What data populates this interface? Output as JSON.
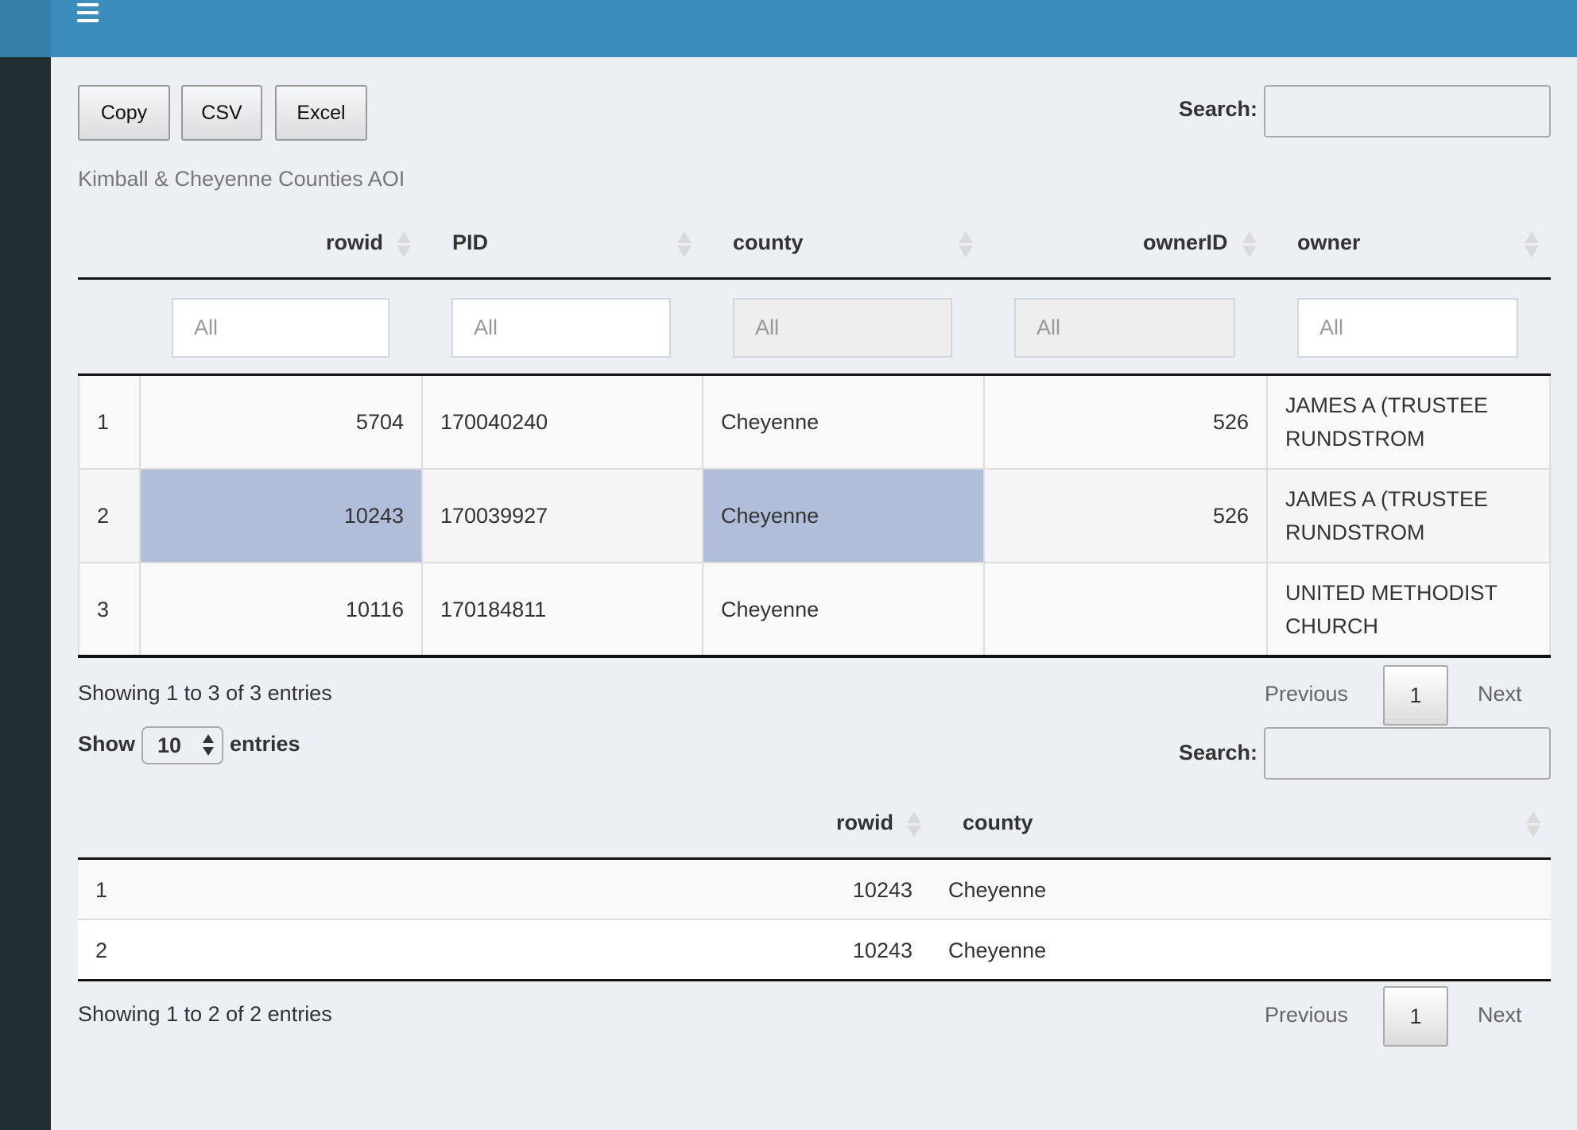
{
  "header": {
    "menu_icon": "hamburger-icon",
    "colors": {
      "header": "#3c8dbc",
      "logo_area": "#367fa9",
      "sidebar": "#222d32",
      "content_bg": "#ecf0f5",
      "selected_cell": "#b0bed9"
    }
  },
  "toolbar": {
    "copy_label": "Copy",
    "csv_label": "CSV",
    "excel_label": "Excel"
  },
  "table1": {
    "search_label": "Search:",
    "search_value": "",
    "caption": "Kimball & Cheyenne Counties AOI",
    "columns": [
      {
        "label": "",
        "sortable": false
      },
      {
        "label": "rowid",
        "sortable": true
      },
      {
        "label": "PID",
        "sortable": true
      },
      {
        "label": "county",
        "sortable": true
      },
      {
        "label": "ownerID",
        "sortable": true
      },
      {
        "label": "owner",
        "sortable": true
      }
    ],
    "filters": [
      {
        "placeholder": "All",
        "disabled": false
      },
      {
        "placeholder": "All",
        "disabled": false
      },
      {
        "placeholder": "All",
        "disabled": true
      },
      {
        "placeholder": "All",
        "disabled": true
      },
      {
        "placeholder": "All",
        "disabled": false
      }
    ],
    "rows": [
      {
        "index": "1",
        "rowid": "5704",
        "pid": "170040240",
        "county": "Cheyenne",
        "ownerID": "526",
        "owner": "JAMES A (TRUSTEE RUNDSTROM",
        "selected": []
      },
      {
        "index": "2",
        "rowid": "10243",
        "pid": "170039927",
        "county": "Cheyenne",
        "ownerID": "526",
        "owner": "JAMES A (TRUSTEE RUNDSTROM",
        "selected": [
          "rowid",
          "county"
        ]
      },
      {
        "index": "3",
        "rowid": "10116",
        "pid": "170184811",
        "county": "Cheyenne",
        "ownerID": "",
        "owner": "UNITED METHODIST CHURCH",
        "selected": []
      }
    ],
    "info": "Showing 1 to 3 of 3 entries",
    "pagination": {
      "previous": "Previous",
      "current": "1",
      "next": "Next"
    }
  },
  "table2": {
    "length_show_label": "Show",
    "length_value": "10",
    "length_entries_label": "entries",
    "search_label": "Search:",
    "search_value": "",
    "columns": [
      {
        "label": ""
      },
      {
        "label": "rowid"
      },
      {
        "label": "county"
      }
    ],
    "rows": [
      {
        "index": "1",
        "rowid": "10243",
        "county": "Cheyenne"
      },
      {
        "index": "2",
        "rowid": "10243",
        "county": "Cheyenne"
      }
    ],
    "info": "Showing 1 to 2 of 2 entries",
    "pagination": {
      "previous": "Previous",
      "current": "1",
      "next": "Next"
    }
  }
}
